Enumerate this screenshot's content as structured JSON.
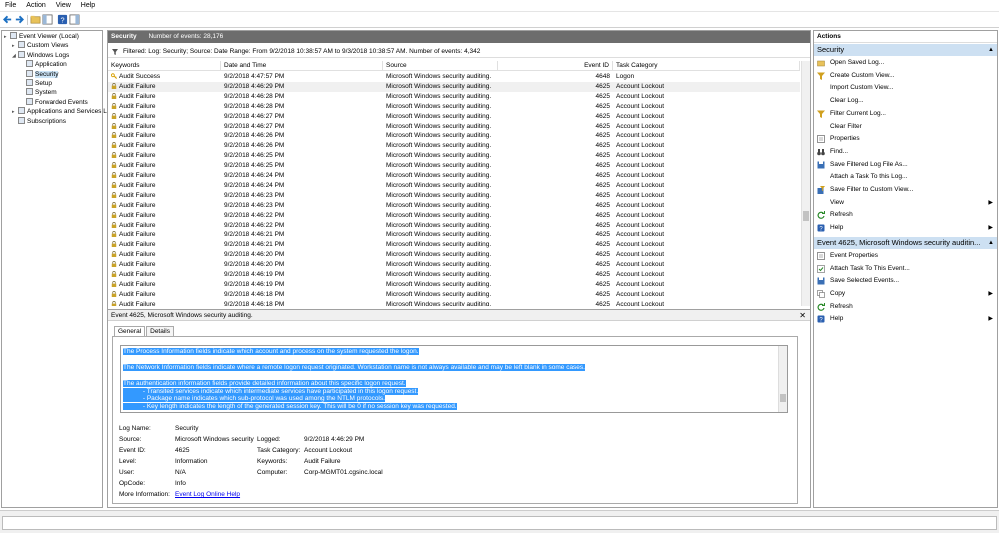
{
  "menu": [
    "File",
    "Action",
    "View",
    "Help"
  ],
  "tree": {
    "items": [
      {
        "label": "Event Viewer (Local)",
        "indent": 0,
        "expander": "▸",
        "selected": false
      },
      {
        "label": "Custom Views",
        "indent": 1,
        "expander": "▸",
        "selected": false
      },
      {
        "label": "Windows Logs",
        "indent": 1,
        "expander": "◢",
        "selected": false
      },
      {
        "label": "Application",
        "indent": 2,
        "expander": "",
        "selected": false
      },
      {
        "label": "Security",
        "indent": 2,
        "expander": "",
        "selected": true
      },
      {
        "label": "Setup",
        "indent": 2,
        "expander": "",
        "selected": false
      },
      {
        "label": "System",
        "indent": 2,
        "expander": "",
        "selected": false
      },
      {
        "label": "Forwarded Events",
        "indent": 2,
        "expander": "",
        "selected": false
      },
      {
        "label": "Applications and Services Lo",
        "indent": 1,
        "expander": "▸",
        "selected": false
      },
      {
        "label": "Subscriptions",
        "indent": 1,
        "expander": "",
        "selected": false
      }
    ]
  },
  "center": {
    "log_name": "Security",
    "event_count": "Number of events: 28,176",
    "filter_text": "Filtered: Log: Security; Source: Date Range: From 9/2/2018 10:38:57 AM to 9/3/2018 10:38:57 AM. Number of events: 4,342",
    "columns": [
      "Keywords",
      "Date and Time",
      "Source",
      "Event ID",
      "Task Category"
    ],
    "rows": [
      {
        "keyword": "Audit Success",
        "date": "9/2/2018 4:47:57 PM",
        "source": "Microsoft Windows security auditing.",
        "id": "4648",
        "task": "Logon",
        "success": true
      },
      {
        "keyword": "Audit Failure",
        "date": "9/2/2018 4:46:29 PM",
        "source": "Microsoft Windows security auditing.",
        "id": "4625",
        "task": "Account Lockout",
        "success": false
      },
      {
        "keyword": "Audit Failure",
        "date": "9/2/2018 4:46:28 PM",
        "source": "Microsoft Windows security auditing.",
        "id": "4625",
        "task": "Account Lockout",
        "success": false
      },
      {
        "keyword": "Audit Failure",
        "date": "9/2/2018 4:46:28 PM",
        "source": "Microsoft Windows security auditing.",
        "id": "4625",
        "task": "Account Lockout",
        "success": false
      },
      {
        "keyword": "Audit Failure",
        "date": "9/2/2018 4:46:27 PM",
        "source": "Microsoft Windows security auditing.",
        "id": "4625",
        "task": "Account Lockout",
        "success": false
      },
      {
        "keyword": "Audit Failure",
        "date": "9/2/2018 4:46:27 PM",
        "source": "Microsoft Windows security auditing.",
        "id": "4625",
        "task": "Account Lockout",
        "success": false
      },
      {
        "keyword": "Audit Failure",
        "date": "9/2/2018 4:46:26 PM",
        "source": "Microsoft Windows security auditing.",
        "id": "4625",
        "task": "Account Lockout",
        "success": false
      },
      {
        "keyword": "Audit Failure",
        "date": "9/2/2018 4:46:26 PM",
        "source": "Microsoft Windows security auditing.",
        "id": "4625",
        "task": "Account Lockout",
        "success": false
      },
      {
        "keyword": "Audit Failure",
        "date": "9/2/2018 4:46:25 PM",
        "source": "Microsoft Windows security auditing.",
        "id": "4625",
        "task": "Account Lockout",
        "success": false
      },
      {
        "keyword": "Audit Failure",
        "date": "9/2/2018 4:46:25 PM",
        "source": "Microsoft Windows security auditing.",
        "id": "4625",
        "task": "Account Lockout",
        "success": false
      },
      {
        "keyword": "Audit Failure",
        "date": "9/2/2018 4:46:24 PM",
        "source": "Microsoft Windows security auditing.",
        "id": "4625",
        "task": "Account Lockout",
        "success": false
      },
      {
        "keyword": "Audit Failure",
        "date": "9/2/2018 4:46:24 PM",
        "source": "Microsoft Windows security auditing.",
        "id": "4625",
        "task": "Account Lockout",
        "success": false
      },
      {
        "keyword": "Audit Failure",
        "date": "9/2/2018 4:46:23 PM",
        "source": "Microsoft Windows security auditing.",
        "id": "4625",
        "task": "Account Lockout",
        "success": false
      },
      {
        "keyword": "Audit Failure",
        "date": "9/2/2018 4:46:23 PM",
        "source": "Microsoft Windows security auditing.",
        "id": "4625",
        "task": "Account Lockout",
        "success": false
      },
      {
        "keyword": "Audit Failure",
        "date": "9/2/2018 4:46:22 PM",
        "source": "Microsoft Windows security auditing.",
        "id": "4625",
        "task": "Account Lockout",
        "success": false
      },
      {
        "keyword": "Audit Failure",
        "date": "9/2/2018 4:46:22 PM",
        "source": "Microsoft Windows security auditing.",
        "id": "4625",
        "task": "Account Lockout",
        "success": false
      },
      {
        "keyword": "Audit Failure",
        "date": "9/2/2018 4:46:21 PM",
        "source": "Microsoft Windows security auditing.",
        "id": "4625",
        "task": "Account Lockout",
        "success": false
      },
      {
        "keyword": "Audit Failure",
        "date": "9/2/2018 4:46:21 PM",
        "source": "Microsoft Windows security auditing.",
        "id": "4625",
        "task": "Account Lockout",
        "success": false
      },
      {
        "keyword": "Audit Failure",
        "date": "9/2/2018 4:46:20 PM",
        "source": "Microsoft Windows security auditing.",
        "id": "4625",
        "task": "Account Lockout",
        "success": false
      },
      {
        "keyword": "Audit Failure",
        "date": "9/2/2018 4:46:20 PM",
        "source": "Microsoft Windows security auditing.",
        "id": "4625",
        "task": "Account Lockout",
        "success": false
      },
      {
        "keyword": "Audit Failure",
        "date": "9/2/2018 4:46:19 PM",
        "source": "Microsoft Windows security auditing.",
        "id": "4625",
        "task": "Account Lockout",
        "success": false
      },
      {
        "keyword": "Audit Failure",
        "date": "9/2/2018 4:46:19 PM",
        "source": "Microsoft Windows security auditing.",
        "id": "4625",
        "task": "Account Lockout",
        "success": false
      },
      {
        "keyword": "Audit Failure",
        "date": "9/2/2018 4:46:18 PM",
        "source": "Microsoft Windows security auditing.",
        "id": "4625",
        "task": "Account Lockout",
        "success": false
      },
      {
        "keyword": "Audit Failure",
        "date": "9/2/2018 4:46:18 PM",
        "source": "Microsoft Windows security auditing.",
        "id": "4625",
        "task": "Account Lockout",
        "success": false
      }
    ]
  },
  "detail": {
    "title": "Event 4625, Microsoft Windows security auditing.",
    "tabs": [
      "General",
      "Details"
    ],
    "message_lines": [
      "The Process Information fields indicate which account and process on the system requested the logon.",
      "",
      "The Network Information fields indicate where a remote logon request originated. Workstation name is not always available and may be left blank in some cases.",
      "",
      "The authentication information fields provide detailed information about this specific logon request.",
      "           - Transited services indicate which intermediate services have participated in this logon request.",
      "           - Package name indicates which sub-protocol was used among the NTLM protocols.",
      "           - Key length indicates the length of the generated session key. This will be 0 if no session key was requested."
    ],
    "labels": {
      "log_name": "Log Name:",
      "source": "Source:",
      "event_id": "Event ID:",
      "level": "Level:",
      "user": "User:",
      "opcode": "OpCode:",
      "more_info": "More Information:",
      "logged": "Logged:",
      "task_category": "Task Category:",
      "keywords": "Keywords:",
      "computer": "Computer:"
    },
    "values": {
      "log_name": "Security",
      "source": "Microsoft Windows security",
      "event_id": "4625",
      "level": "Information",
      "user": "N/A",
      "opcode": "Info",
      "more_info": "Event Log Online Help",
      "logged": "9/2/2018 4:46:29 PM",
      "task_category": "Account Lockout",
      "keywords": "Audit Failure",
      "computer": "Corp-MGMT01.cgsinc.local"
    }
  },
  "actions": {
    "title": "Actions",
    "sections": [
      {
        "header": "Security",
        "items": [
          {
            "label": "Open Saved Log...",
            "icon": "folder-icon",
            "submenu": false
          },
          {
            "label": "Create Custom View...",
            "icon": "filter-icon",
            "submenu": false
          },
          {
            "label": "Import Custom View...",
            "icon": "",
            "submenu": false
          },
          {
            "label": "Clear Log...",
            "icon": "",
            "submenu": false
          },
          {
            "label": "Filter Current Log...",
            "icon": "filter-icon",
            "submenu": false
          },
          {
            "label": "Clear Filter",
            "icon": "",
            "submenu": false
          },
          {
            "label": "Properties",
            "icon": "properties-icon",
            "submenu": false
          },
          {
            "label": "Find...",
            "icon": "binoculars-icon",
            "submenu": false
          },
          {
            "label": "Save Filtered Log File As...",
            "icon": "save-icon",
            "submenu": false
          },
          {
            "label": "Attach a Task To this Log...",
            "icon": "",
            "submenu": false
          },
          {
            "label": "Save Filter to Custom View...",
            "icon": "save-filter-icon",
            "submenu": false
          },
          {
            "label": "View",
            "icon": "",
            "submenu": true
          },
          {
            "label": "Refresh",
            "icon": "refresh-icon",
            "submenu": false
          },
          {
            "label": "Help",
            "icon": "help-icon",
            "submenu": true
          }
        ]
      },
      {
        "header": "Event 4625, Microsoft Windows security auditin...",
        "items": [
          {
            "label": "Event Properties",
            "icon": "properties-icon",
            "submenu": false
          },
          {
            "label": "Attach Task To This Event...",
            "icon": "task-icon",
            "submenu": false
          },
          {
            "label": "Save Selected Events...",
            "icon": "save-icon",
            "submenu": false
          },
          {
            "label": "Copy",
            "icon": "copy-icon",
            "submenu": true
          },
          {
            "label": "Refresh",
            "icon": "refresh-icon",
            "submenu": false
          },
          {
            "label": "Help",
            "icon": "help-icon",
            "submenu": true
          }
        ]
      }
    ]
  },
  "colors": {
    "header_dark": "#6d6d6d",
    "section_blue": "#cde0f2",
    "selection": "#3399ff",
    "audit_success": "#d8a000",
    "audit_failure": "#c9a227",
    "link": "#0000ee"
  }
}
